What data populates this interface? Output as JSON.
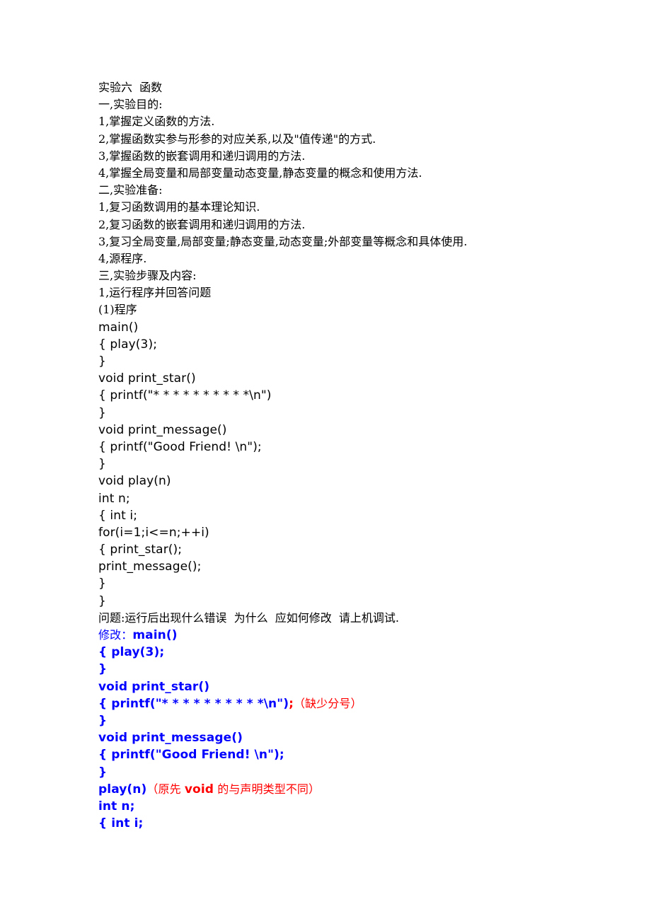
{
  "document": {
    "title": "实验六  函数",
    "section1": {
      "heading": "一,实验目的:",
      "items": [
        "1,掌握定义函数的方法.",
        "2,掌握函数实参与形参的对应关系,以及\"值传递\"的方式.",
        "3,掌握函数的嵌套调用和递归调用的方法.",
        "4,掌握全局变量和局部变量动态变量,静态变量的概念和使用方法."
      ]
    },
    "section2": {
      "heading": "二,实验准备:",
      "items": [
        "1,复习函数调用的基本理论知识.",
        "2,复习函数的嵌套调用和递归调用的方法.",
        "3,复习全局变量,局部变量;静态变量,动态变量;外部变量等概念和具体使用.",
        "4,源程序."
      ]
    },
    "section3": {
      "heading": "三,实验步骤及内容:",
      "step1": "1,运行程序并回答问题",
      "program_label": "(1)程序",
      "code_lines": [
        "main()",
        "{ play(3);",
        "}",
        "void print_star()",
        "{ printf(\"* * * * * * * * * *\\n\")",
        "}",
        "void print_message()",
        "{ printf(\"Good Friend! \\n\");",
        "}",
        "void play(n)",
        "int n;",
        "{ int i;",
        "for(i=1;i<=n;++i)",
        "{ print_star();",
        "print_message();",
        "}",
        "}"
      ],
      "question": "问题:运行后出现什么错误  为什么  应如何修改  请上机调试.",
      "fix": {
        "label": "修改：",
        "lines": [
          {
            "code": "main()"
          },
          {
            "code": "{ play(3);"
          },
          {
            "code": "}"
          },
          {
            "code": "void print_star()"
          },
          {
            "code": "{ printf(\"* * * * * * * * * *\\n\")",
            "red_code": ";",
            "note": "（缺少分号）"
          },
          {
            "code": "}"
          },
          {
            "code": "void print_message()"
          },
          {
            "code": "{ printf(\"Good Friend! \\n\");"
          },
          {
            "code": "}"
          },
          {
            "code": "play(n)",
            "note_prefix": "（原先 ",
            "note_bold": "void",
            "note_suffix": " 的与声明类型不同）"
          },
          {
            "code": "int n;"
          },
          {
            "code": "{ int i;"
          }
        ]
      }
    }
  },
  "colors": {
    "text": "#000000",
    "fix_code": "#0000ff",
    "annotation": "#ff0000"
  }
}
